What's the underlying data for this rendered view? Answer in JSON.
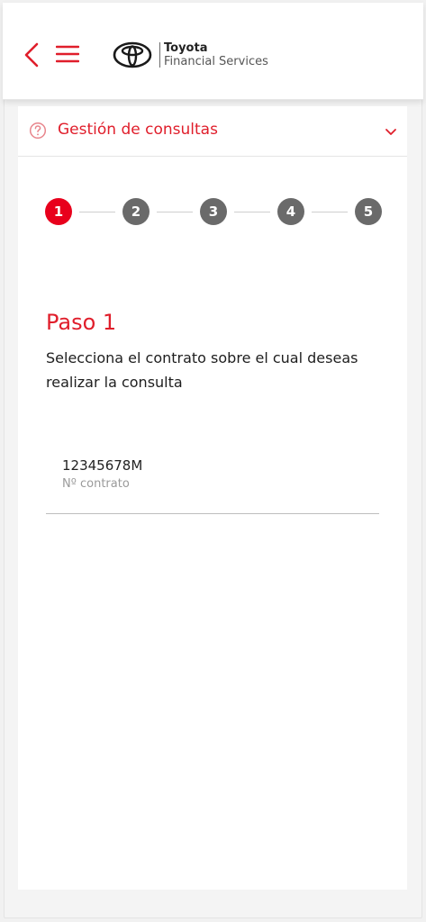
{
  "header": {
    "brand_line1": "Toyota",
    "brand_line2": "Financial Services"
  },
  "accordion": {
    "title": "Gestión de consultas"
  },
  "stepper": {
    "steps": [
      "1",
      "2",
      "3",
      "4",
      "5"
    ],
    "active_index": 0
  },
  "step": {
    "title": "Paso 1",
    "description": "Selecciona el contrato sobre el cual deseas realizar la consulta"
  },
  "contract": {
    "value": "12345678M",
    "label": "Nº contrato"
  },
  "colors": {
    "accent": "#e01e2b",
    "step_active": "#e8001c",
    "step_inactive": "#6a6a6a"
  },
  "icons": {
    "back": "chevron-left-icon",
    "menu": "hamburger-menu-icon",
    "logo": "toyota-logo-icon",
    "help": "help-circle-icon",
    "expand": "chevron-down-icon"
  }
}
